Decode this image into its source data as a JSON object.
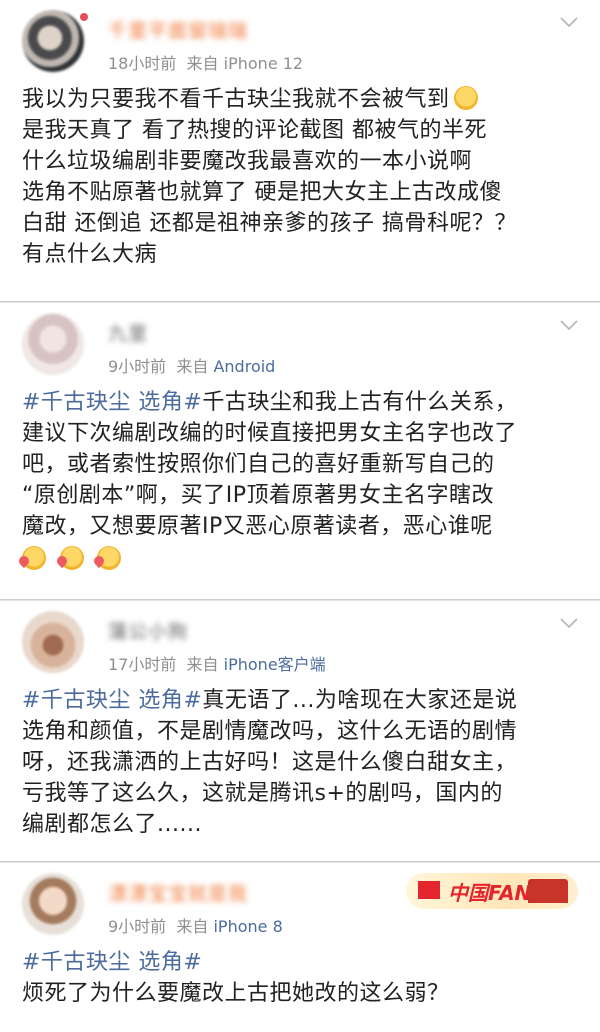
{
  "posts": [
    {
      "username": "千里平面窗瑞瑞",
      "time": "18小时前",
      "via": "来自",
      "source": "iPhone 12",
      "lines": [
        "我以为只要我不看千古玦尘我就不会被气到",
        "是我天真了 看了热搜的评论截图 都被气的半死",
        "什么垃圾编剧非要魔改我最喜欢的一本小说啊",
        "选角不贴原著也就算了 硬是把大女主上古改成傻",
        "白甜 还倒追 还都是祖神亲爹的孩子 搞骨科呢？？",
        "有点什么大病"
      ]
    },
    {
      "username": "九里",
      "time": "9小时前",
      "via": "来自",
      "source": "Android",
      "topic": "#千古玦尘 选角#",
      "lines": [
        "千古玦尘和我上古有什么关系，",
        "建议下次编剧改编的时候直接把男女主名字也改了",
        "吧，或者索性按照你们自己的喜好重新写自己的",
        "“原创剧本”啊，买了IP顶着原著男女主名字瞎改",
        "魔改，又想要原著IP又恶心原著读者，恶心谁呢"
      ]
    },
    {
      "username": "蒲公小狗",
      "time": "17小时前",
      "via": "来自",
      "source": "iPhone客户端",
      "topic": "#千古玦尘 选角#",
      "lines": [
        "真无语了...为啥现在大家还是说",
        "选角和颜值，不是剧情魔改吗，这什么无语的剧情",
        "呀，还我潇洒的上古好吗！这是什么傻白甜女主，",
        "亏我等了这么久，这就是腾讯s+的剧吗，国内的",
        "编剧都怎么了......"
      ]
    },
    {
      "username": "漂漂宝宝就是我",
      "time": "9小时前",
      "via": "来自",
      "source": "iPhone 8",
      "badge_text": "中国FANS",
      "topic": "#千古玦尘 选角#",
      "lines": [
        "烦死了为什么要魔改上古把她改的这么弱？"
      ]
    }
  ],
  "icons": {
    "chevron": "chevron-down-icon",
    "emoji_smile": "smile-emoji-icon",
    "emoji_heart": "heart-kiss-emoji-icon"
  },
  "colors": {
    "link": "#4c6b9e",
    "meta": "#8f8f8f",
    "username_orange": "#f07a3a"
  }
}
